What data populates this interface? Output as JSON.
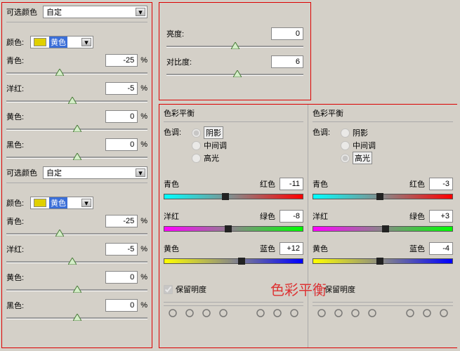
{
  "selColor": {
    "title": "可选颜色",
    "preset": "自定",
    "colorLabel": "颜色:",
    "colorName": "黄色",
    "top": {
      "cyan": {
        "label": "青色:",
        "value": "-25",
        "pos": 38
      },
      "magenta": {
        "label": "洋红:",
        "value": "-5",
        "pos": 47
      },
      "yellow": {
        "label": "黄色:",
        "value": "0",
        "pos": 50
      },
      "black": {
        "label": "黑色:",
        "value": "0",
        "pos": 50
      }
    },
    "bottom": {
      "cyan": {
        "label": "青色:",
        "value": "-25",
        "pos": 38
      },
      "magenta": {
        "label": "洋红:",
        "value": "-5",
        "pos": 47
      },
      "yellow": {
        "label": "黄色:",
        "value": "0",
        "pos": 50
      },
      "black": {
        "label": "黑色:",
        "value": "0",
        "pos": 50
      }
    }
  },
  "bc": {
    "brightness": {
      "label": "亮度:",
      "value": "0",
      "pos": 50
    },
    "contrast": {
      "label": "对比度:",
      "value": "6",
      "pos": 52
    }
  },
  "cb": {
    "title": "色彩平衡",
    "toneLabel": "色调:",
    "tones": {
      "shadows": "阴影",
      "midtones": "中间调",
      "highlights": "高光"
    },
    "sliders": {
      "cr": {
        "l": "青色",
        "r": "红色"
      },
      "mg": {
        "l": "洋红",
        "r": "绿色"
      },
      "yb": {
        "l": "黄色",
        "r": "蓝色"
      }
    },
    "preserve": "保留明度",
    "left": {
      "tone": "shadows",
      "cr": {
        "v": "-11",
        "pos": 44
      },
      "mg": {
        "v": "-8",
        "pos": 46
      },
      "yb": {
        "v": "+12",
        "pos": 56
      }
    },
    "right": {
      "tone": "highlights",
      "cr": {
        "v": "-3",
        "pos": 48
      },
      "mg": {
        "v": "+3",
        "pos": 52
      },
      "yb": {
        "v": "-4",
        "pos": 48
      }
    }
  },
  "annotation": "色彩平衡"
}
